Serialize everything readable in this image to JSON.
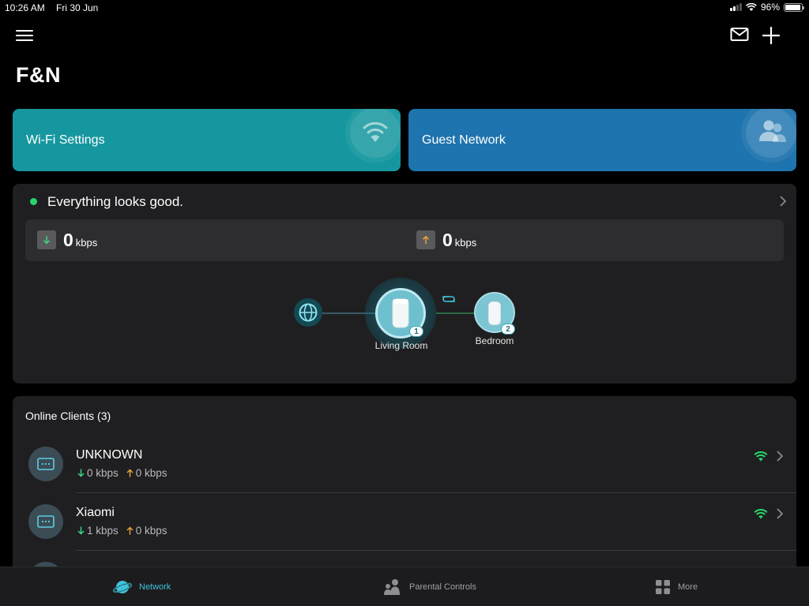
{
  "status_bar": {
    "time": "10:26 AM",
    "date": "Fri 30 Jun",
    "battery": "96%",
    "battery_level": 0.96
  },
  "header": {
    "title": "F&N",
    "menu_icon": "hamburger-menu-icon",
    "mail_icon": "mail-icon",
    "add_icon": "plus-icon"
  },
  "cards": {
    "wifi": {
      "label": "Wi-Fi Settings",
      "icon": "wifi-icon",
      "color": "#16979f"
    },
    "guest": {
      "label": "Guest Network",
      "icon": "guest-users-icon",
      "color": "#1e74ae"
    }
  },
  "network_status": {
    "message": "Everything looks good.",
    "status_color": "#2ad46c",
    "download": {
      "value": "0",
      "unit": "kbps"
    },
    "upload": {
      "value": "0",
      "unit": "kbps"
    }
  },
  "topology": {
    "nodes": [
      {
        "name": "Living Room",
        "badge": "1"
      },
      {
        "name": "Bedroom",
        "badge": "2"
      }
    ]
  },
  "clients": {
    "title": "Online Clients (3)",
    "items": [
      {
        "name": "UNKNOWN",
        "download": "0 kbps",
        "upload": "0 kbps"
      },
      {
        "name": "Xiaomi",
        "download": "1 kbps",
        "upload": "0 kbps"
      }
    ]
  },
  "tabs": [
    {
      "label": "Network",
      "icon": "network-planet-icon",
      "active": true
    },
    {
      "label": "Parental Controls",
      "icon": "parental-controls-icon",
      "active": false
    },
    {
      "label": "More",
      "icon": "grid-more-icon",
      "active": false
    }
  ]
}
